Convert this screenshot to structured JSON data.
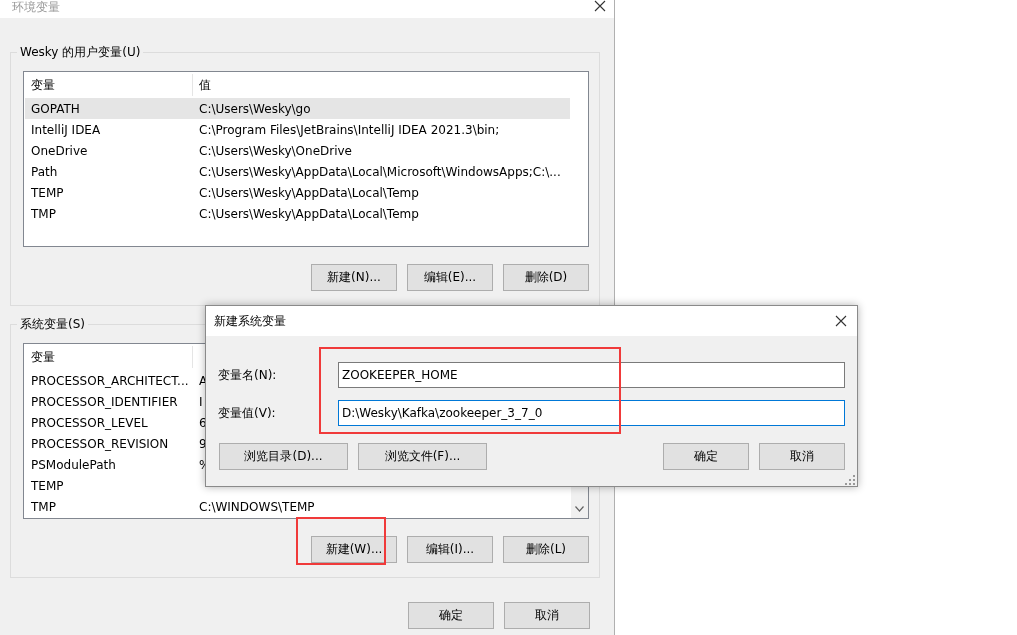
{
  "window": {
    "title": "环境变量"
  },
  "user_vars": {
    "label": "Wesky 的用户变量(U)",
    "columns": [
      "变量",
      "值"
    ],
    "rows": [
      {
        "name": "GOPATH",
        "value": "C:\\Users\\Wesky\\go",
        "selected": true
      },
      {
        "name": "IntelliJ IDEA",
        "value": "C:\\Program Files\\JetBrains\\IntelliJ IDEA 2021.3\\bin;",
        "selected": false
      },
      {
        "name": "OneDrive",
        "value": "C:\\Users\\Wesky\\OneDrive",
        "selected": false
      },
      {
        "name": "Path",
        "value": "C:\\Users\\Wesky\\AppData\\Local\\Microsoft\\WindowsApps;C:\\...",
        "selected": false
      },
      {
        "name": "TEMP",
        "value": "C:\\Users\\Wesky\\AppData\\Local\\Temp",
        "selected": false
      },
      {
        "name": "TMP",
        "value": "C:\\Users\\Wesky\\AppData\\Local\\Temp",
        "selected": false
      }
    ],
    "buttons": [
      {
        "label": "新建(N)...",
        "highlighted": false
      },
      {
        "label": "编辑(E)...",
        "highlighted": false
      },
      {
        "label": "删除(D)",
        "highlighted": false
      }
    ]
  },
  "system_vars": {
    "label": "系统变量(S)",
    "columns": [
      "变量"
    ],
    "rows": [
      {
        "name": "PROCESSOR_ARCHITECT...",
        "value": "A",
        "selected": false
      },
      {
        "name": "PROCESSOR_IDENTIFIER",
        "value": "I",
        "selected": false
      },
      {
        "name": "PROCESSOR_LEVEL",
        "value": "6",
        "selected": false
      },
      {
        "name": "PROCESSOR_REVISION",
        "value": "9",
        "selected": false
      },
      {
        "name": "PSModulePath",
        "value": "%",
        "selected": false
      },
      {
        "name": "TEMP",
        "selected": false
      },
      {
        "name": "TMP",
        "value": "C:\\WINDOWS\\TEMP",
        "selected": false
      }
    ],
    "buttons": [
      {
        "label": "新建(W)...",
        "highlighted": true
      },
      {
        "label": "编辑(I)...",
        "highlighted": false
      },
      {
        "label": "删除(L)",
        "highlighted": false
      }
    ]
  },
  "buttons": [
    "确定",
    "取消"
  ],
  "dialog": {
    "title": "新建系统变量",
    "highlighted": true,
    "fields": [
      {
        "label": "变量名(N):",
        "value": "ZOOKEEPER_HOME",
        "focused": false
      },
      {
        "label": "变量值(V):",
        "value": "D:\\Wesky\\Kafka\\zookeeper_3_7_0",
        "focused": true
      }
    ],
    "left_buttons": [
      "浏览目录(D)...",
      "浏览文件(F)..."
    ],
    "buttons": [
      "确定",
      "取消"
    ]
  }
}
